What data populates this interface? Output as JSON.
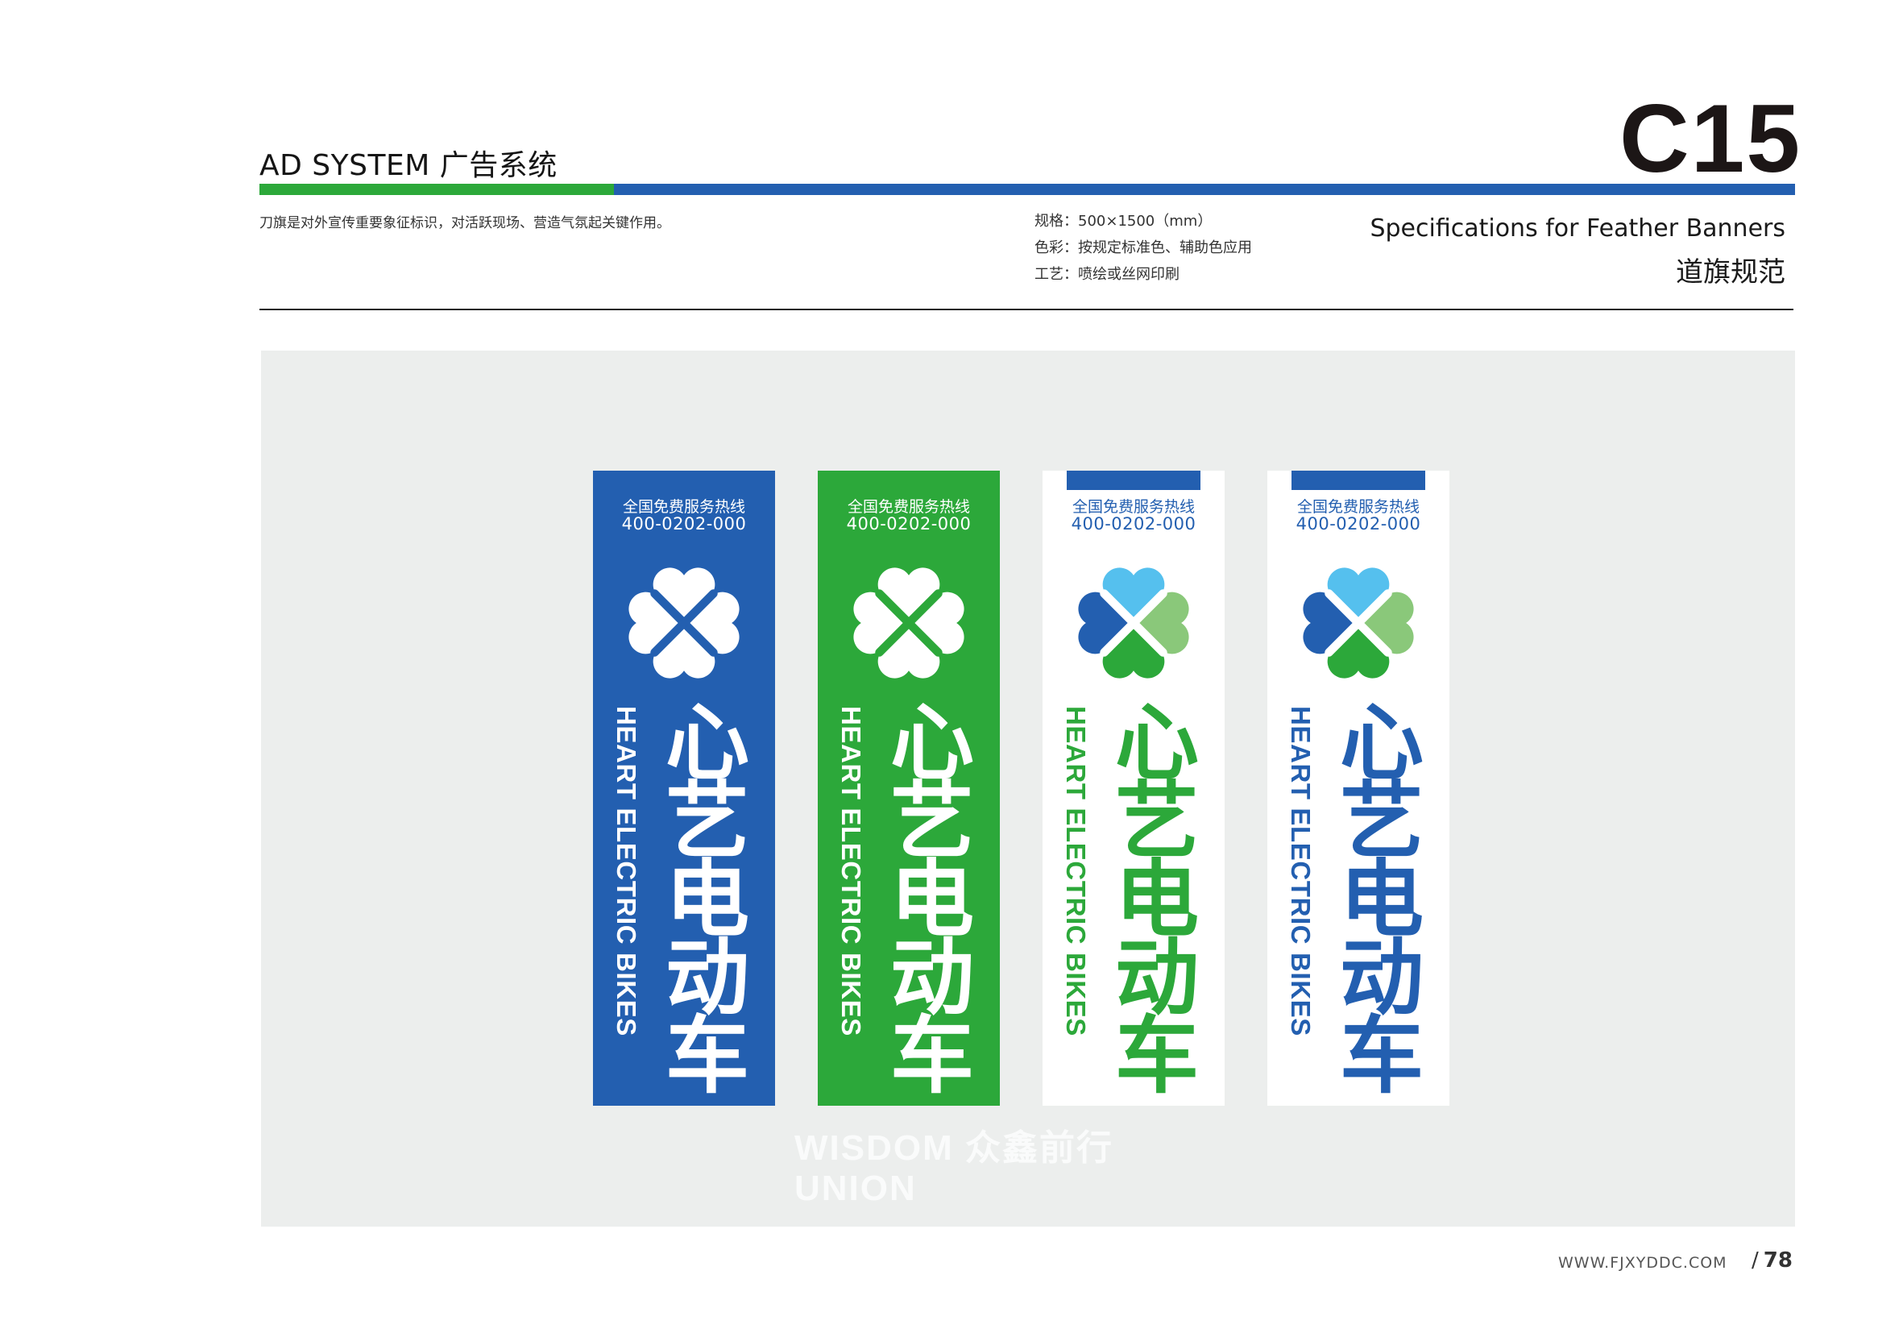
{
  "header": {
    "title": "AD SYSTEM 广告系统",
    "page_code": "C15"
  },
  "description": "刀旗是对外宣传重要象征标识，对活跃现场、营造气氛起关键作用。",
  "specs": {
    "size": "规格：500×1500（mm）",
    "color": "色彩：按规定标准色、辅助色应用",
    "craft": "工艺：喷绘或丝网印刷"
  },
  "section": {
    "title_en": "Specifications for   Feather Banners",
    "title_cn": "道旗规范"
  },
  "banners": [
    {
      "hotline_label": "全国免费服务热线",
      "hotline_number": "400-0202-000",
      "brand_cn": "心\n艺\n电\n动\n车",
      "brand_en": "HEART ELECTRIC BIKES",
      "style": "blue"
    },
    {
      "hotline_label": "全国免费服务热线",
      "hotline_number": "400-0202-000",
      "brand_cn": "心\n艺\n电\n动\n车",
      "brand_en": "HEART ELECTRIC BIKES",
      "style": "green"
    },
    {
      "hotline_label": "全国免费服务热线",
      "hotline_number": "400-0202-000",
      "brand_cn": "心\n艺\n电\n动\n车",
      "brand_en": "HEART ELECTRIC BIKES",
      "style": "white-green"
    },
    {
      "hotline_label": "全国免费服务热线",
      "hotline_number": "400-0202-000",
      "brand_cn": "心\n艺\n电\n动\n车",
      "brand_en": "HEART ELECTRIC BIKES",
      "style": "white-blue"
    }
  ],
  "watermark": "WISDOM 众鑫前行\nUNION",
  "footer": {
    "url": "WWW.FJXYDDC.COM",
    "page_slash": "/",
    "page_number": "78"
  },
  "colors": {
    "brand_blue": "#235fb0",
    "brand_green": "#2ca83a",
    "clover_light_blue": "#55c0ee",
    "clover_light_green": "#8ac87a",
    "panel_gray": "#eceeed"
  }
}
